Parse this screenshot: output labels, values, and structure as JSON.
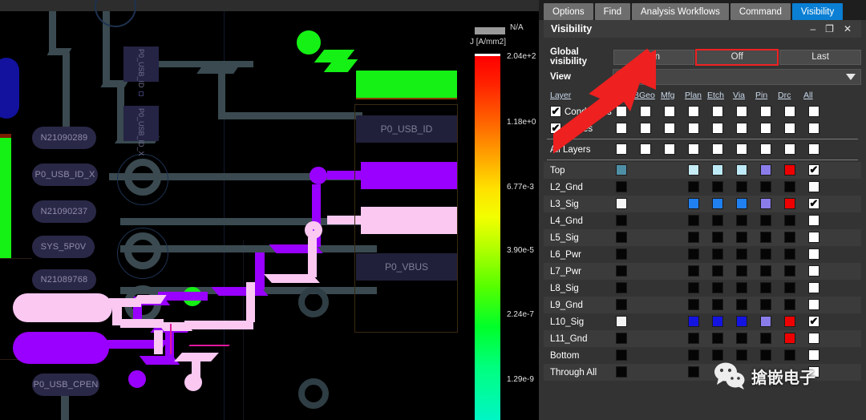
{
  "tabs": [
    {
      "label": "Options",
      "active": false
    },
    {
      "label": "Find",
      "active": false
    },
    {
      "label": "Analysis Workflows",
      "active": false
    },
    {
      "label": "Command",
      "active": false
    },
    {
      "label": "Visibility",
      "active": true
    }
  ],
  "window": {
    "title": "Visibility",
    "minimize": "–",
    "restore": "❐",
    "close": "✕"
  },
  "global_visibility": {
    "label": "Global visibility",
    "buttons": [
      "On",
      "Off",
      "Last"
    ],
    "highlighted": "Off",
    "highlight_color": "#ef2222"
  },
  "view": {
    "label": "View",
    "value": "",
    "placeholder": ""
  },
  "columns": [
    "Layer",
    "",
    "BGeo",
    "Mfg",
    "Plan",
    "Etch",
    "Via",
    "Pin",
    "Drc",
    "All"
  ],
  "groups": [
    {
      "name": "Conductors",
      "checked": true,
      "cells": [
        "w",
        "w",
        "w",
        "w",
        "w",
        "w",
        "w",
        "w",
        "w"
      ]
    },
    {
      "name": "Planes",
      "checked": true,
      "cells": [
        "w",
        "w",
        "w",
        "w",
        "w",
        "w",
        "w",
        "w",
        "w"
      ]
    }
  ],
  "all_layers": {
    "name": "All Layers",
    "cells": [
      "w",
      "w",
      "w",
      "w",
      "w",
      "w",
      "w",
      "w",
      "w"
    ]
  },
  "layers": [
    {
      "name": "Top",
      "colors": [
        "#4f8fa6",
        null,
        "#c6ecf5",
        "#bdeaf7",
        "#bfeaf7",
        "#8a7dea",
        "#ef0000"
      ],
      "all_checked": true
    },
    {
      "name": "L2_Gnd",
      "colors": [
        "#050505",
        null,
        "#050505",
        "#050505",
        "#050505",
        "#050505",
        "#050505"
      ],
      "all_checked": false
    },
    {
      "name": "L3_Sig",
      "colors": [
        "#f4f4f4",
        null,
        "#2080ef",
        "#2080ef",
        "#2080ef",
        "#8a7dea",
        "#ef0000"
      ],
      "all_checked": true
    },
    {
      "name": "L4_Gnd",
      "colors": [
        "#050505",
        null,
        "#050505",
        "#050505",
        "#050505",
        "#050505",
        "#050505"
      ],
      "all_checked": false
    },
    {
      "name": "L5_Sig",
      "colors": [
        "#050505",
        null,
        "#050505",
        "#050505",
        "#050505",
        "#050505",
        "#050505"
      ],
      "all_checked": false
    },
    {
      "name": "L6_Pwr",
      "colors": [
        "#050505",
        null,
        "#050505",
        "#050505",
        "#050505",
        "#050505",
        "#050505"
      ],
      "all_checked": false
    },
    {
      "name": "L7_Pwr",
      "colors": [
        "#050505",
        null,
        "#050505",
        "#050505",
        "#050505",
        "#050505",
        "#050505"
      ],
      "all_checked": false
    },
    {
      "name": "L8_Sig",
      "colors": [
        "#050505",
        null,
        "#050505",
        "#050505",
        "#050505",
        "#050505",
        "#050505"
      ],
      "all_checked": false
    },
    {
      "name": "L9_Gnd",
      "colors": [
        "#050505",
        null,
        "#050505",
        "#050505",
        "#050505",
        "#050505",
        "#050505"
      ],
      "all_checked": false
    },
    {
      "name": "L10_Sig",
      "colors": [
        "#f4f4f4",
        null,
        "#1414e0",
        "#1414e0",
        "#1414e0",
        "#8a7dea",
        "#ef0000"
      ],
      "all_checked": true
    },
    {
      "name": "L11_Gnd",
      "colors": [
        "#050505",
        null,
        "#050505",
        "#050505",
        "#050505",
        "#050505",
        "#ef0000"
      ],
      "all_checked": false
    },
    {
      "name": "Bottom",
      "colors": [
        "#050505",
        null,
        "#050505",
        "#050505",
        "#050505",
        "#050505",
        "#050505"
      ],
      "all_checked": false
    },
    {
      "name": "Through All",
      "colors": [
        "#050505",
        null,
        "#050505",
        null,
        null,
        null,
        null
      ],
      "all_checked": false
    }
  ],
  "colorbar": {
    "na_label": "N/A",
    "na_color": "#9a9a9a",
    "unit_label": "J [A/mm2]",
    "ticks": [
      "2.04e+2",
      "1.18e+0",
      "6.77e-3",
      "3.90e-5",
      "2.24e-7",
      "1.29e-9"
    ]
  },
  "pcb": {
    "net_pills": [
      "N21090289",
      "P0_USB_ID_X",
      "N21090237",
      "SYS_5P0V",
      "N21089768",
      "P0_USB_CPEN"
    ],
    "pad_labels": [
      "P0_USB_ID",
      "P0_VBUS"
    ],
    "vertical_pads": [
      "P0_USB_ID",
      "P0_USB_ID_X"
    ]
  },
  "watermark": {
    "text": "搶嵌电子",
    "icon": "wechat-icon"
  }
}
